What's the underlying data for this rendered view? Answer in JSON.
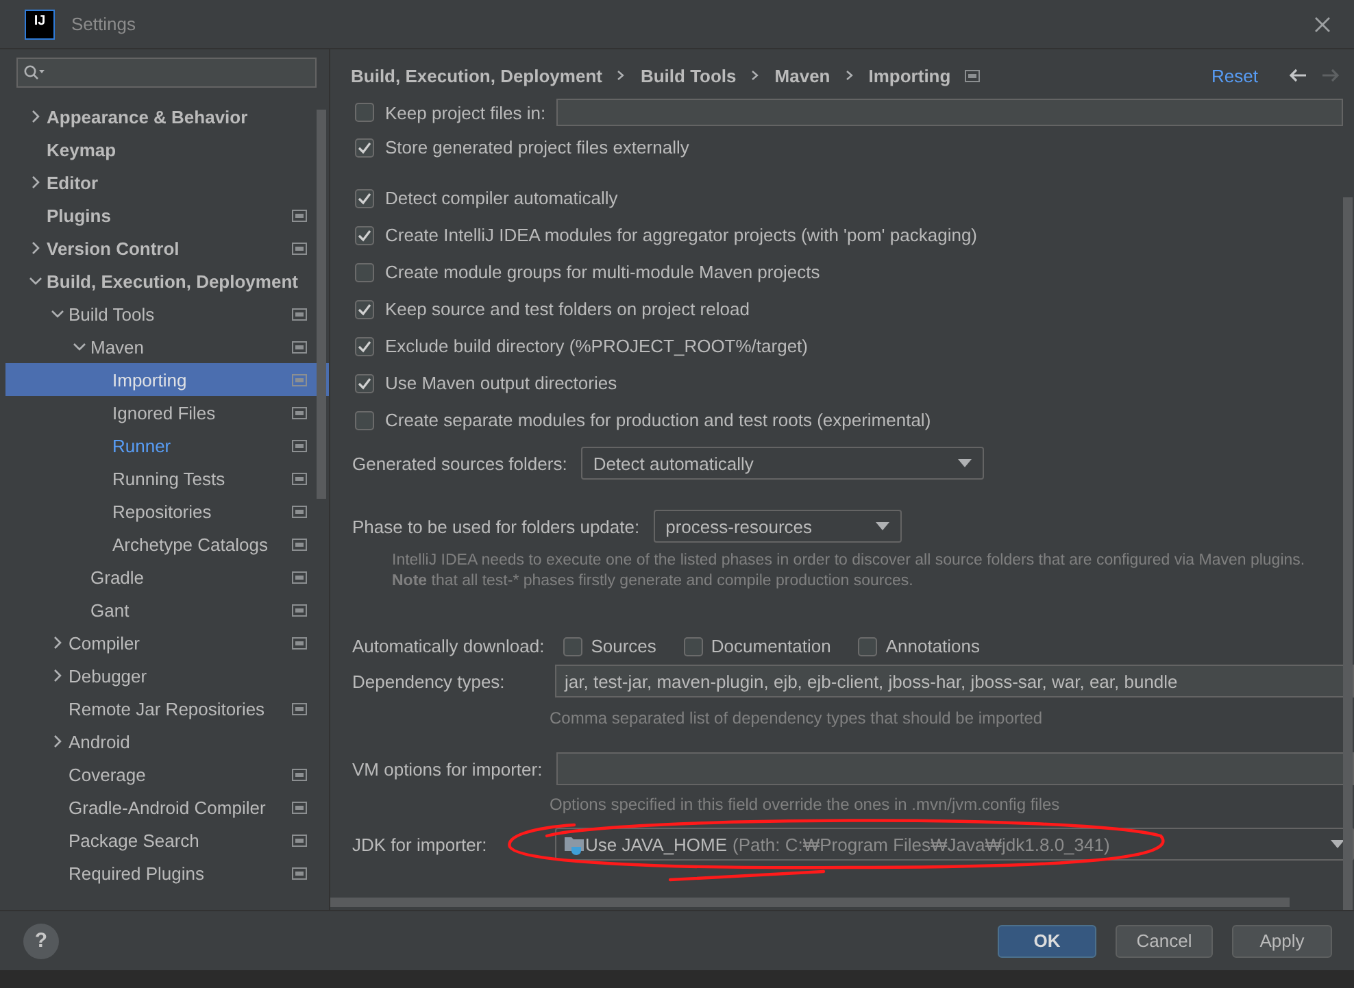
{
  "window": {
    "title": "Settings",
    "logo_text": "IJ"
  },
  "sidebar": {
    "items": [
      {
        "label": "Appearance & Behavior",
        "expanded": false,
        "selected": false,
        "modified": false,
        "project_level": false
      },
      {
        "label": "Keymap",
        "selected": false,
        "modified": false,
        "project_level": false
      },
      {
        "label": "Editor",
        "expanded": false,
        "selected": false,
        "modified": false,
        "project_level": false
      },
      {
        "label": "Plugins",
        "selected": false,
        "modified": false,
        "project_level": true
      },
      {
        "label": "Version Control",
        "expanded": false,
        "selected": false,
        "modified": false,
        "project_level": true
      },
      {
        "label": "Build, Execution, Deployment",
        "expanded": true,
        "selected": false,
        "modified": false,
        "project_level": false,
        "children": [
          {
            "label": "Build Tools",
            "expanded": true,
            "selected": false,
            "modified": false,
            "project_level": true,
            "children": [
              {
                "label": "Maven",
                "expanded": true,
                "selected": false,
                "modified": false,
                "project_level": true,
                "children": [
                  {
                    "label": "Importing",
                    "selected": true,
                    "modified": false,
                    "project_level": true
                  },
                  {
                    "label": "Ignored Files",
                    "selected": false,
                    "modified": false,
                    "project_level": true
                  },
                  {
                    "label": "Runner",
                    "selected": false,
                    "modified": true,
                    "project_level": true
                  },
                  {
                    "label": "Running Tests",
                    "selected": false,
                    "modified": false,
                    "project_level": true
                  },
                  {
                    "label": "Repositories",
                    "selected": false,
                    "modified": false,
                    "project_level": true
                  },
                  {
                    "label": "Archetype Catalogs",
                    "selected": false,
                    "modified": false,
                    "project_level": true
                  }
                ]
              },
              {
                "label": "Gradle",
                "selected": false,
                "modified": false,
                "project_level": true
              },
              {
                "label": "Gant",
                "selected": false,
                "modified": false,
                "project_level": true
              }
            ]
          },
          {
            "label": "Compiler",
            "expanded": false,
            "selected": false,
            "modified": false,
            "project_level": true
          },
          {
            "label": "Debugger",
            "expanded": false,
            "selected": false,
            "modified": false,
            "project_level": false
          },
          {
            "label": "Remote Jar Repositories",
            "selected": false,
            "modified": false,
            "project_level": true
          },
          {
            "label": "Android",
            "expanded": false,
            "selected": false,
            "modified": false,
            "project_level": false
          },
          {
            "label": "Coverage",
            "selected": false,
            "modified": false,
            "project_level": true
          },
          {
            "label": "Gradle-Android Compiler",
            "selected": false,
            "modified": false,
            "project_level": true
          },
          {
            "label": "Package Search",
            "selected": false,
            "modified": false,
            "project_level": true
          },
          {
            "label": "Required Plugins",
            "selected": false,
            "modified": false,
            "project_level": true
          }
        ]
      }
    ]
  },
  "header": {
    "breadcrumbs": [
      "Build, Execution, Deployment",
      "Build Tools",
      "Maven",
      "Importing"
    ],
    "reset": "Reset",
    "back_enabled": true,
    "forward_enabled": false
  },
  "options": [
    {
      "label": "Keep project files in:",
      "checked": false
    },
    {
      "label": "Store generated project files externally",
      "checked": true
    },
    {
      "label": "Detect compiler automatically",
      "checked": true
    },
    {
      "label": "Create IntelliJ IDEA modules for aggregator projects (with 'pom' packaging)",
      "checked": true
    },
    {
      "label": "Create module groups for multi-module Maven projects",
      "checked": false
    },
    {
      "label": "Keep source and test folders on project reload",
      "checked": true
    },
    {
      "label": "Exclude build directory (%PROJECT_ROOT%/target)",
      "checked": true
    },
    {
      "label": "Use Maven output directories",
      "checked": true
    },
    {
      "label": "Create separate modules for production and test roots (experimental)",
      "checked": false
    }
  ],
  "generated_sources": {
    "label": "Generated sources folders:",
    "value": "Detect automatically"
  },
  "phase": {
    "label": "Phase to be used for folders update:",
    "value": "process-resources",
    "hint": "IntelliJ IDEA needs to execute one of the listed phases in order to discover all source folders that are configured via Maven plugins.",
    "note": "**Note** that all test-* phases firstly generate and compile production sources."
  },
  "auto_download": {
    "label": "Automatically download:",
    "options": [
      {
        "label": "Sources",
        "checked": false
      },
      {
        "label": "Documentation",
        "checked": false
      },
      {
        "label": "Annotations",
        "checked": false
      }
    ]
  },
  "dependency_types": {
    "label": "Dependency types:",
    "value": "jar, test-jar, maven-plugin, ejb, ejb-client, jboss-har, jboss-sar, war, ear, bundle",
    "hint": "Comma separated list of dependency types that should be imported"
  },
  "vm_options": {
    "label": "VM options for importer:",
    "hint": "Options specified in this field override the ones in .mvn/jvm.config files"
  },
  "jdk": {
    "label": "JDK for importer:",
    "value": "Use JAVA_HOME",
    "detail": "(Path: C:₩Program Files₩Java₩jdk1.8.0_341)",
    "circled": true
  },
  "buttons": [
    {
      "label": "OK",
      "primary": true
    },
    {
      "label": "Cancel",
      "primary": false
    },
    {
      "label": "Apply",
      "primary": false
    }
  ],
  "help": "?"
}
